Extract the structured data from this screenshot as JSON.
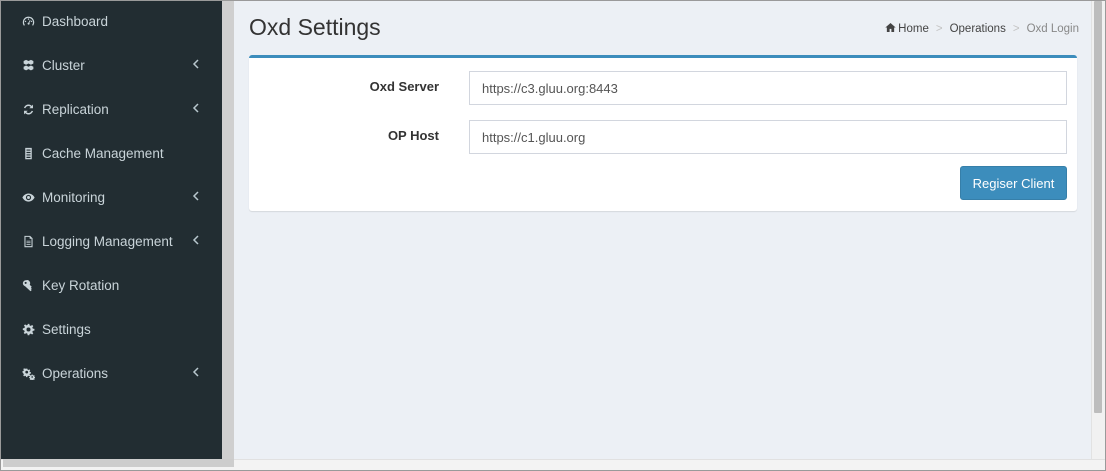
{
  "sidebar": {
    "items": [
      {
        "label": "Dashboard",
        "icon": "dashboard-icon",
        "has_children": false
      },
      {
        "label": "Cluster",
        "icon": "cubes-icon",
        "has_children": true
      },
      {
        "label": "Replication",
        "icon": "refresh-icon",
        "has_children": true
      },
      {
        "label": "Cache Management",
        "icon": "database-icon",
        "has_children": false
      },
      {
        "label": "Monitoring",
        "icon": "eye-icon",
        "has_children": true
      },
      {
        "label": "Logging Management",
        "icon": "file-text-icon",
        "has_children": true
      },
      {
        "label": "Key Rotation",
        "icon": "key-icon",
        "has_children": false
      },
      {
        "label": "Settings",
        "icon": "gear-icon",
        "has_children": false
      },
      {
        "label": "Operations",
        "icon": "gears-icon",
        "has_children": true
      }
    ]
  },
  "header": {
    "title": "Oxd Settings",
    "breadcrumb": {
      "home": "Home",
      "section": "Operations",
      "current": "Oxd Login"
    }
  },
  "form": {
    "oxd_server": {
      "label": "Oxd Server",
      "value": "https://c3.gluu.org:8443"
    },
    "op_host": {
      "label": "OP Host",
      "value": "https://c1.gluu.org"
    },
    "submit_label": "Regiser Client"
  },
  "colors": {
    "sidebar_bg": "#222d32",
    "accent": "#3c8dbc",
    "content_bg": "#ecf0f5"
  }
}
